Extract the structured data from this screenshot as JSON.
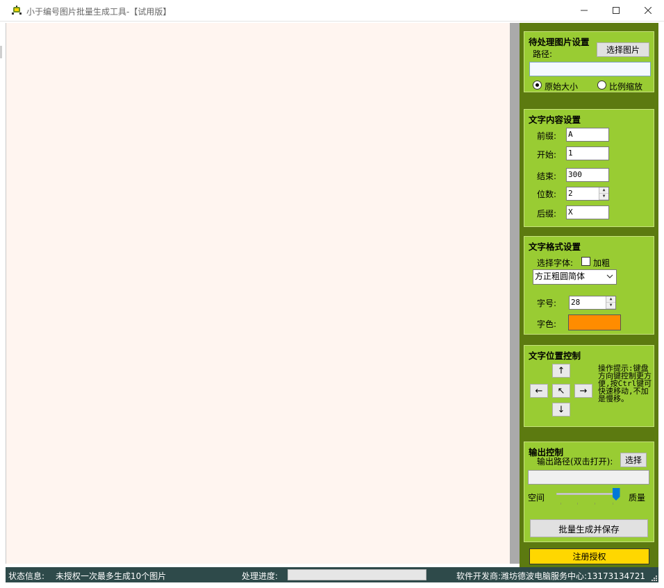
{
  "window": {
    "title": "小于编号图片批量生成工具-【试用版】",
    "icons": [
      "app-icon",
      "minimize-icon",
      "maximize-icon",
      "close-icon"
    ]
  },
  "image_settings": {
    "title": "待处理图片设置",
    "path_label": "路径:",
    "select_button": "选择图片",
    "path_value": "",
    "size_options": [
      {
        "label": "原始大小",
        "checked": true
      },
      {
        "label": "比例缩放",
        "checked": false
      }
    ]
  },
  "text_content": {
    "title": "文字内容设置",
    "prefix_label": "前缀:",
    "prefix_value": "A",
    "start_label": "开始:",
    "start_value": "1",
    "end_label": "结束:",
    "end_value": "300",
    "digits_label": "位数:",
    "digits_value": "2",
    "suffix_label": "后缀:",
    "suffix_value": "X"
  },
  "text_format": {
    "title": "文字格式设置",
    "font_label": "选择字体:",
    "bold_label": "加粗",
    "bold_checked": false,
    "font_value": "方正粗圆简体",
    "size_label": "字号:",
    "size_value": "28",
    "color_label": "字色:",
    "color_value": "#ff8c00"
  },
  "text_position": {
    "title": "文字位置控制",
    "arrows": {
      "up": "↑",
      "left": "←",
      "center": "↖",
      "right": "→",
      "down": "↓"
    },
    "hint": "操作提示:键盘方向键控制更方便,按Ctrl键可快速移动,不加是慢移。"
  },
  "output": {
    "title": "输出控制",
    "path_label": "输出路径(双击打开):",
    "select_button": "选择",
    "path_value": "",
    "slider_left": "空间",
    "slider_right": "质量",
    "slider_level": 1.0,
    "generate_button": "批量生成并保存"
  },
  "register_button": "注册授权",
  "status": {
    "info_label": "状态信息:",
    "info_value": "未授权一次最多生成10个图片",
    "progress_label": "处理进度:",
    "progress_value": 0,
    "developer": "软件开发商:潍坊德波电脑服务中心:13173134721"
  },
  "colors": {
    "panel_background": "#5c7a10",
    "group_background": "#99cc33",
    "canvas_background": "#fff5f0",
    "statusbar_background": "#2e4a4a",
    "register_button": "#ffd700"
  }
}
